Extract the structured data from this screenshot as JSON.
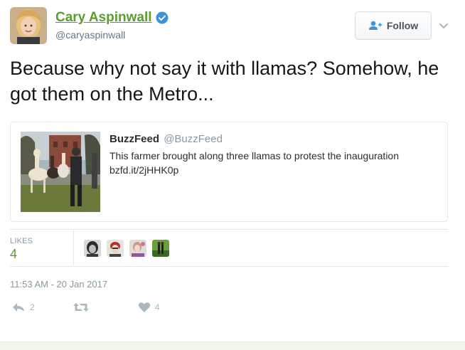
{
  "author": {
    "display_name": "Cary Aspinwall",
    "handle": "@caryaspinwall",
    "verified": true
  },
  "follow_button": {
    "label": "Follow",
    "icon": "follow-user-icon"
  },
  "tweet": {
    "text": "Because why not say it with llamas? Somehow, he got them on the Metro..."
  },
  "quoted_tweet": {
    "author": "BuzzFeed",
    "handle": "@BuzzFeed",
    "text": "This farmer brought along three llamas to protest the inauguration",
    "link": "bzfd.it/2jHHK0p"
  },
  "stats": {
    "likes_label": "LIKES",
    "likes_count": "4",
    "likers": 4
  },
  "timestamp": "11:53 AM - 20 Jan 2017",
  "actions": {
    "reply_count": "2",
    "retweet_count": "",
    "like_count": "4"
  },
  "colors": {
    "accent": "#5a9e2e",
    "verified": "#3b94d9",
    "muted": "#8899a6"
  }
}
